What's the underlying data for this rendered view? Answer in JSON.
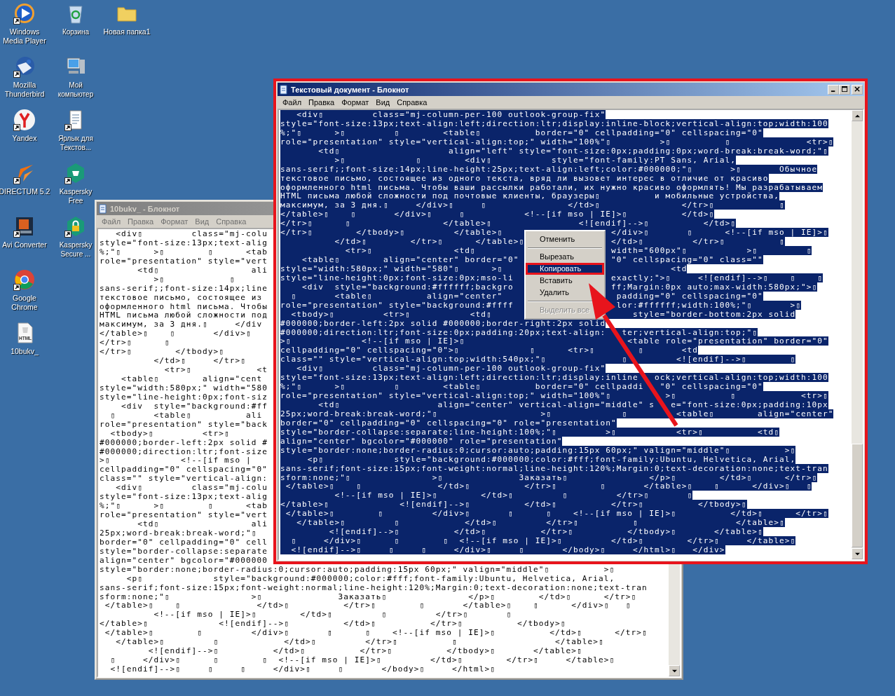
{
  "desktop": {
    "icon_columns": [
      [
        {
          "label": "Windows Media Player",
          "kind": "media-player",
          "shortcut": true
        },
        {
          "label": "Mozilla Thunderbird",
          "kind": "mail-bird",
          "shortcut": true
        },
        {
          "label": "Yandex",
          "kind": "fork-logo",
          "shortcut": true
        },
        {
          "label": "DIRECTUM 5.2",
          "kind": "chevron-logo",
          "shortcut": true
        },
        {
          "label": "Avi Converter",
          "kind": "film",
          "shortcut": true
        },
        {
          "label": "Google Chrome",
          "kind": "ring-logo",
          "shortcut": true
        },
        {
          "label": "10bukv_",
          "kind": "html-file",
          "badge": "HTML",
          "shortcut": false
        }
      ],
      [
        {
          "label": "Корзина",
          "kind": "recycle-bin",
          "shortcut": false
        },
        {
          "label": "Мой компьютер",
          "kind": "computer",
          "shortcut": false
        },
        {
          "label": "Ярлык для Текстов...",
          "kind": "document",
          "shortcut": true
        },
        {
          "label": "Kaspersky Free",
          "kind": "hexagon",
          "shortcut": true
        },
        {
          "label": "Kaspersky Secure ...",
          "kind": "lock-hexagon",
          "shortcut": true
        }
      ],
      [
        {
          "label": "Новая папка1",
          "kind": "folder",
          "shortcut": false
        }
      ]
    ]
  },
  "windows": [
    {
      "title": "10bukv_ - Блокнот",
      "active": false,
      "selection": false,
      "menu": [
        "Файл",
        "Правка",
        "Формат",
        "Вид",
        "Справка"
      ],
      "lines": [
        "   <div▯         class=\"mj-colu",
        "style=\"font-size:13px;text-alig",
        "%;\"▯      >▯        ▯      <tab",
        "role=\"presentation\" style=\"vert",
        "       <td▯                 ali",
        "          >▯            ▯",
        "sans-serif;;font-size:14px;line",
        "текстовое письмо, состоящее из",
        "оформленного html письма. Чтобы",
        "HTML письма любой сложности под",
        "максимум, за 3 дня.▯     </div",
        "</table>▯    ▯       </div>▯",
        "</tr>▯      ▯",
        "</tr>▯        </tbody>▯",
        "          </td>▯     </tr>▯",
        "            <tr>▯            <t",
        "    <table▯        align=\"cent",
        "style=\"width:580px;\" width=\"580",
        "style=\"line-height:0px;font-siz",
        "    <div  style=\"background:#ff",
        "  ▯       <table▯          ali",
        "role=\"presentation\" style=\"back",
        "  <tbody>▯         <tr>▯",
        "#000000;border-left:2px solid #",
        "#000000;direction:ltr;font-size",
        ">▯             <!--[if mso |",
        "cellpadding=\"0\" cellspacing=\"0\"",
        "class=\"\" style=\"vertical-align:",
        "   <div▯         class=\"mj-colu",
        "style=\"font-size:13px;text-alig",
        "%;\"▯      >▯        ▯      <tab",
        "role=\"presentation\" style=\"vert",
        "       <td▯                 ali",
        "25px;word-break:break-word;\"▯",
        "border=\"0\" cellpadding=\"0\" cell",
        "style=\"border-collapse:separate",
        "align=\"center\" bgcolor=\"#000000",
        "style=\"border:none;border-radius:0;cursor:auto;padding:15px 60px;\" valign=\"middle\"▯          >▯",
        "     <p▯             style=\"background:#000000;color:#fff;font-family:Ubuntu, Helvetica, Arial,",
        "sans-serif;font-size:15px;font-weight:normal;line-height:120%;Margin:0;text-decoration:none;text-tran",
        "sform:none;\"▯               >▯              Заказать▯               </p>▯        </td>▯      </tr>▯",
        " </table>▯    ▯              </td>▯          </tr>▯        ▯       </table>▯    ▯      </div>▯   ▯",
        "          <!--[if mso | IE]>▯        </td>▯         ▯         </tr>▯       ▯",
        "</table>▯             <![endif]-->▯          </td>▯          </tr>▯          </tbody>▯",
        " </table>▯        ▯         </div>▯       ▯      ▯    <!--[if mso | IE]>▯          </td>▯      </tr>▯",
        "   </table>▯         ▯            </td>▯         </tr>▯          ▯                  </table>▯",
        "         <![endif]-->▯          </td>▯          </tr>▯          </tbody>▯       </table>▯",
        "  ▯     </div>▯      ▯        ▯  <!--[if mso | IE]>▯         </td>▯        </tr>▯     </table>▯",
        "  <![endif]-->▯     ▯     ▯     </div>▯     ▯       </body>▯     </html>▯"
      ]
    },
    {
      "title": "Текстовый документ - Блокнот",
      "active": true,
      "selection": true,
      "menu": [
        "Файл",
        "Правка",
        "Формат",
        "Вид",
        "Справка"
      ],
      "lines": [
        "   <div▯         class=\"mj-column-per-100 outlook-group-fix\"",
        "style=\"font-size:13px;text-align:left;direction:ltr;display:inline-block;vertical-align:top;width:100",
        "%;\"▯      >▯         ▯        <table▯          border=\"0\" cellpadding=\"0\" cellspacing=\"0\"",
        "role=\"presentation\" style=\"vertical-align:top;\" width=\"100%\"▯         >▯          ▯              <tr>▯",
        "       <td▯                    align=\"left\" style=\"font-size:0px;padding:0px;word-break:break-word;\"▯",
        "          >▯             ▯        <div▯           style=\"font-family:PT Sans, Arial,",
        "sans-serif;;font-size:14px;line-height:25px;text-align:left;color:#000000;\"▯       >▯       Обычное",
        "текстовое письмо, состоящее из одного текста, вряд ли вызовет интерес в отличие от красиво",
        "оформленного html письма. Чтобы ваши рассылки работали, их нужно красиво оформлять! Мы разрабатываем",
        "HTML письма любой сложности под почтовые клиенты, браузеры▯          и мобильные устройства,",
        "максимум, за 3 дня.▯     </div>▯     ▯               </td>▯               </tr>▯            ▯",
        "</table>▯    ▯       </div>▯     ▯           <!--[if mso | IE]>▯          </td>▯",
        "</tr>▯      ▯                 </table>▯                <![endif]-->▯          </td>▯",
        "</tr>▯        </tbody>▯         </table>▯                    </div>▯       ▯      <!--[if mso | IE]>▯",
        "          </td>▯        </tr>▯      </table>▯                </td>▯         </tr>▯          ▯",
        "            <tr>▯               <td▯                         width=\"600px\"▯           >▯         ▯",
        "    <table▯        align=\"center\" border=\"0\"                 \"0\" cellspacing=\"0\" class=\"\"",
        "style=\"width:580px;\" width=\"580\"▯      >▯                               <td",
        "style=\"line-height:0px;font-size:0px;mso-li                  exactly;\">▯     <![endif]-->▯    ▯    ▯",
        "    <div  style=\"background:#ffffff;backgro                  ff;Margin:0px auto;max-width:580px;\">▯",
        "  ▯       <table▯          align=\"center\"                     padding=\"0\" cellspacing=\"0\"",
        "role=\"presentation\" style=\"background:#ffff                   lor:#ffffff;width:100%;\"▯       >▯",
        "  <tbody>▯         <tr>▯           <td▯                          style=\"border-bottom:2px solid",
        "#000000;border-left:2px solid #000000;border-right:2px solid",
        "#000000;direction:ltr;font-size:0px;padding:20px;text-align:   ter;vertical-align:top;\"▯",
        ">▯             <!--[if mso | IE]>▯                              <table role=\"presentation\" border=\"0\"",
        "cellpadding=\"0\" cellspacing=\"0\">▯             ▯      <tr>▯        ▯       <td",
        "class=\"\" style=\"vertical-align:top;width:540px;\"▯              ▯         <![endif]-->▯        ▯",
        "   <div▯         class=\"mj-column-per-100 outlook-group-fix\"",
        "style=\"font-size:13px;text-align:left;direction:ltr;display:inline   ock;vertical-align:top;width:100",
        "%;\"▯      >▯         ▯        <table▯          border=\"0\" cellpaddi   \"0\" cellspacing=\"0\"",
        "role=\"presentation\" style=\"vertical-align:top;\" width=\"100%\"▯          >▯          ▯            <tr>▯",
        "       <td▯                  align=\"center\" vertical-align=\"middle\" s   e=\"font-size:0px;padding:10px",
        "25px;word-break:break-word;\"▯                   >▯             ▯         <table▯        align=\"center\"",
        "border=\"0\" cellpadding=\"0\" cellspacing=\"0\" role=\"presentation\"",
        "style=\"border-collapse:separate;line-height:100%;\"▯         >▯           <tr>▯          <td▯",
        "align=\"center\" bgcolor=\"#000000\" role=\"presentation\"",
        "style=\"border:none;border-radius:0;cursor:auto;padding:15px 60px;\" valign=\"middle\"▯          >▯",
        "     <p▯             style=\"background:#000000;color:#fff;font-family:Ubuntu, Helvetica, Arial,",
        "sans-serif;font-size:15px;font-weight:normal;line-height:120%;Margin:0;text-decoration:none;text-tran",
        "sform:none;\"▯               >▯              Заказать▯               </p>▯        </td>▯      </tr>▯",
        " </table>▯    ▯              </td>▯          </tr>▯        ▯       </table>▯    ▯      </div>▯   ▯",
        "          <!--[if mso | IE]>▯        </td>▯         ▯         </tr>▯       ▯",
        "</table>▯             <![endif]-->▯          </td>▯          </tr>▯          </tbody>▯",
        " </table>▯        ▯         </div>▯       ▯      ▯    <!--[if mso | IE]>▯          </td>▯      </tr>▯",
        "   </table>▯         ▯            </td>▯         </tr>▯          ▯                  </table>▯",
        "         <![endif]-->▯          </td>▯          </tr>▯          </tbody>▯       </table>▯",
        "  ▯     </div>▯      ▯        ▯  <!--[if mso | IE]>▯         </td>▯        </tr>▯     </table>▯",
        "  <![endif]-->▯     ▯     ▯     </div>▯     ▯       </body>▯     </html>▯   </div>"
      ]
    }
  ],
  "context_menu": {
    "items": [
      {
        "kind": "item",
        "label": "Отменить",
        "disabled": false,
        "selected": false
      },
      {
        "kind": "separator"
      },
      {
        "kind": "item",
        "label": "Вырезать",
        "disabled": false,
        "selected": false
      },
      {
        "kind": "item",
        "label": "Копировать",
        "disabled": false,
        "selected": true
      },
      {
        "kind": "item",
        "label": "Вставить",
        "disabled": false,
        "selected": false
      },
      {
        "kind": "item",
        "label": "Удалить",
        "disabled": false,
        "selected": false
      },
      {
        "kind": "separator"
      },
      {
        "kind": "item",
        "label": "Выделить все",
        "disabled": true,
        "selected": false
      }
    ]
  }
}
